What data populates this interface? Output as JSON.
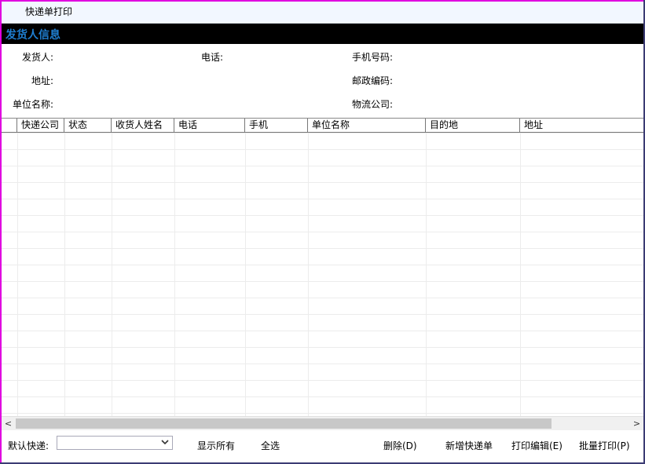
{
  "window": {
    "title": "快递单打印"
  },
  "sender_section": {
    "title": "发货人信息",
    "fields": {
      "sender_label": "发货人:",
      "phone_label": "电话:",
      "mobile_label": "手机号码:",
      "address_label": "地址:",
      "postcode_label": "邮政编码:",
      "company_label": "单位名称:",
      "logistics_label": "物流公司:"
    }
  },
  "grid": {
    "columns": [
      "快递公司",
      "状态",
      "收货人姓名",
      "电话",
      "手机",
      "单位名称",
      "目的地",
      "地址"
    ],
    "rows": []
  },
  "scrollbar": {
    "left_arrow": "<",
    "right_arrow": ">"
  },
  "bottom": {
    "default_express_label": "默认快递:",
    "default_express_value": "",
    "dropdown_icon": "chevron-down-icon",
    "show_all": "显示所有",
    "select_all": "全选",
    "delete": "删除(D)",
    "new_waybill": "新增快递单",
    "print_edit": "打印编辑(E)",
    "batch_print": "批量打印(P)"
  }
}
